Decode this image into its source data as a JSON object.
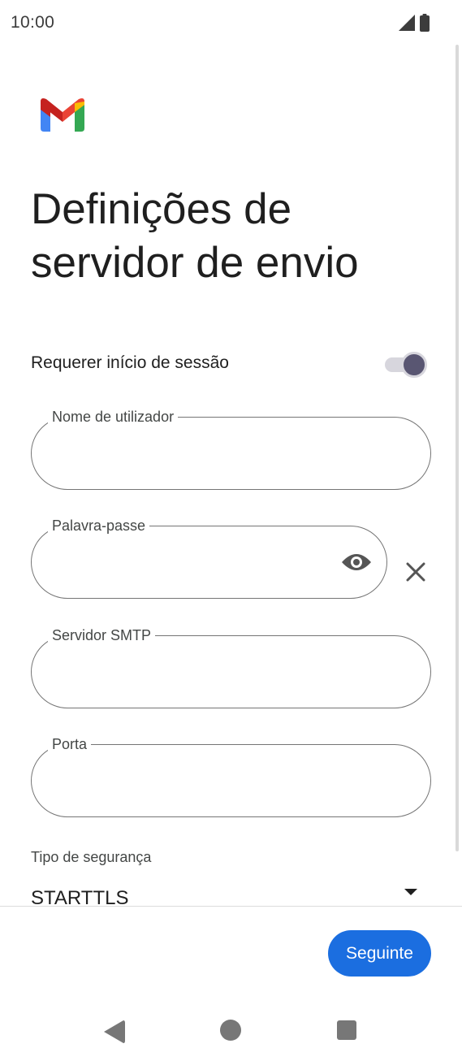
{
  "status_bar": {
    "time": "10:00",
    "icons": [
      "signal-icon",
      "battery-icon"
    ]
  },
  "app": {
    "logo": "gmail-logo-icon",
    "title": "Definições de\nservidor de envio"
  },
  "sign_in_toggle": {
    "label": "Requerer início de sessão",
    "enabled": true
  },
  "fields": {
    "username": {
      "label": "Nome de utilizador",
      "value": ""
    },
    "password": {
      "label": "Palavra-passe",
      "value": ""
    },
    "smtp_server": {
      "label": "Servidor SMTP",
      "value": ""
    },
    "port": {
      "label": "Porta",
      "value": ""
    }
  },
  "security": {
    "label": "Tipo de segurança",
    "selected": "STARTTLS"
  },
  "footer": {
    "next_label": "Seguinte"
  },
  "nav_bar": {
    "icons": [
      "back-icon",
      "home-icon",
      "recents-icon"
    ]
  },
  "colors": {
    "accent": "#1b6ee0",
    "toggle_thumb": "#595672",
    "toggle_track": "#d7d6dd",
    "field_border": "#757575"
  }
}
